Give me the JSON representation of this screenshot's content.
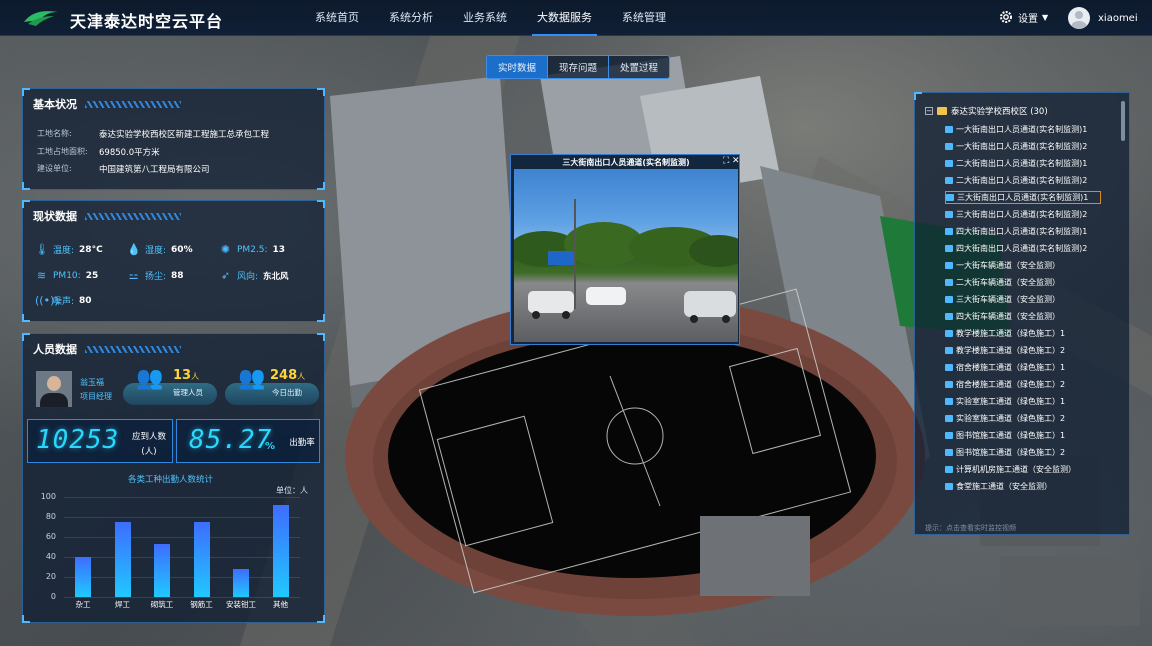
{
  "app": {
    "title": "天津泰达时空云平台"
  },
  "nav": [
    {
      "label": "系统首页",
      "active": false
    },
    {
      "label": "系统分析",
      "active": false
    },
    {
      "label": "业务系统",
      "active": false
    },
    {
      "label": "大数据服务",
      "active": true
    },
    {
      "label": "系统管理",
      "active": false
    }
  ],
  "settings": {
    "label": "设置"
  },
  "user": {
    "name": "xiaomei"
  },
  "tabs": [
    {
      "label": "实时数据",
      "active": true
    },
    {
      "label": "现存问题",
      "active": false
    },
    {
      "label": "处置过程",
      "active": false
    }
  ],
  "basic": {
    "title": "基本状况",
    "rows": [
      {
        "k": "工地名称:",
        "v": "泰达实验学校西校区新建工程施工总承包工程"
      },
      {
        "k": "工地占地面积:",
        "v": "69850.0平方米"
      },
      {
        "k": "建设单位:",
        "v": "中国建筑第八工程局有限公司"
      }
    ]
  },
  "status": {
    "title": "现状数据",
    "temp": {
      "label": "温度:",
      "value": "28°C"
    },
    "humidity": {
      "label": "湿度:",
      "value": "60%"
    },
    "pm25": {
      "label": "PM2.5:",
      "value": "13"
    },
    "pm10": {
      "label": "PM10:",
      "value": "25"
    },
    "dust": {
      "label": "扬尘:",
      "value": "88"
    },
    "wind": {
      "label": "风向:",
      "value": "东北风"
    },
    "noise": {
      "label": "噪声:",
      "value": "80"
    }
  },
  "personnel": {
    "title": "人员数据",
    "manager_name": "翁玉福",
    "manager_role": "项目经理",
    "mgmt_count": "13",
    "mgmt_unit": "人",
    "mgmt_label": "管理人员",
    "today_count": "248",
    "today_unit": "人",
    "today_label": "今日出勤",
    "expected": "10253",
    "expected_label_1": "应到人数",
    "expected_label_2": "(人)",
    "rate": "85.27",
    "rate_unit": "%",
    "rate_label": "出勤率"
  },
  "chart_data": {
    "type": "bar",
    "title": "各类工种出勤人数统计",
    "unit": "单位：人",
    "categories": [
      "杂工",
      "焊工",
      "砌筑工",
      "钢筋工",
      "安装钳工",
      "其他"
    ],
    "values": [
      40,
      75,
      53,
      75,
      28,
      92
    ],
    "ylim": [
      0,
      100
    ],
    "yticks": [
      "100",
      "80",
      "60",
      "40",
      "20",
      "0"
    ],
    "colors": {
      "top": "#3d6dff",
      "bottom": "#21c8ff"
    }
  },
  "video": {
    "title": "三大街南出口人员通道(实名制监测)",
    "expand": "⛶",
    "close": "✕"
  },
  "tree": {
    "root": "泰达实验学校西校区 (30)",
    "items": [
      {
        "label": "一大街南出口人员通道(实名制监测)1",
        "selected": false
      },
      {
        "label": "一大街南出口人员通道(实名制监测)2",
        "selected": false
      },
      {
        "label": "二大街南出口人员通道(实名制监测)1",
        "selected": false
      },
      {
        "label": "二大街南出口人员通道(实名制监测)2",
        "selected": false
      },
      {
        "label": "三大街南出口人员通道(实名制监测)1",
        "selected": true
      },
      {
        "label": "三大街南出口人员通道(实名制监测)2",
        "selected": false
      },
      {
        "label": "四大街南出口人员通道(实名制监测)1",
        "selected": false
      },
      {
        "label": "四大街南出口人员通道(实名制监测)2",
        "selected": false
      },
      {
        "label": "一大街车辆通道（安全监测）",
        "selected": false
      },
      {
        "label": "二大街车辆通道（安全监测）",
        "selected": false
      },
      {
        "label": "三大街车辆通道（安全监测）",
        "selected": false
      },
      {
        "label": "四大街车辆通道（安全监测）",
        "selected": false
      },
      {
        "label": "教学楼施工通道（绿色施工）1",
        "selected": false
      },
      {
        "label": "教学楼施工通道（绿色施工）2",
        "selected": false
      },
      {
        "label": "宿舍楼施工通道（绿色施工）1",
        "selected": false
      },
      {
        "label": "宿舍楼施工通道（绿色施工）2",
        "selected": false
      },
      {
        "label": "实验室施工通道（绿色施工）1",
        "selected": false
      },
      {
        "label": "实验室施工通道（绿色施工）2",
        "selected": false
      },
      {
        "label": "图书馆施工通道（绿色施工）1",
        "selected": false
      },
      {
        "label": "图书馆施工通道（绿色施工）2",
        "selected": false
      },
      {
        "label": "计算机机房施工通道（安全监测）",
        "selected": false
      },
      {
        "label": "食堂施工通道（安全监测）",
        "selected": false
      }
    ],
    "hint": "提示：点击查看实时监控视频"
  }
}
